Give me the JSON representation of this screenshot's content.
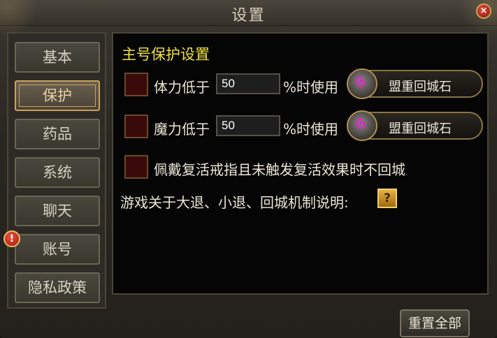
{
  "window": {
    "title": "设置",
    "close_label": "×"
  },
  "sidebar": {
    "tabs": [
      {
        "label": "基本",
        "active": false
      },
      {
        "label": "保护",
        "active": true
      },
      {
        "label": "药品",
        "active": false
      },
      {
        "label": "系统",
        "active": false
      },
      {
        "label": "聊天",
        "active": false
      },
      {
        "label": "账号",
        "active": false,
        "alert": "!"
      },
      {
        "label": "隐私政策",
        "active": false
      }
    ]
  },
  "protection": {
    "section_title": "主号保护设置",
    "hp_row": {
      "label": "体力低于",
      "value": "50",
      "suffix": "%时使用",
      "item": "盟重回城石",
      "checked": false
    },
    "mp_row": {
      "label": "魔力低于",
      "value": "50",
      "suffix": "%时使用",
      "item": "盟重回城石",
      "checked": false
    },
    "ring_row": {
      "label": "佩戴复活戒指且未触发复活效果时不回城",
      "checked": false
    },
    "help_text": "游戏关于大退、小退、回城机制说明:",
    "help_icon": "?"
  },
  "footer": {
    "reset_label": "重置全部"
  },
  "colors": {
    "section_title": "#f0e040",
    "checkbox_fill": "#3a0a0a",
    "accent_gold": "#c9a45a"
  }
}
